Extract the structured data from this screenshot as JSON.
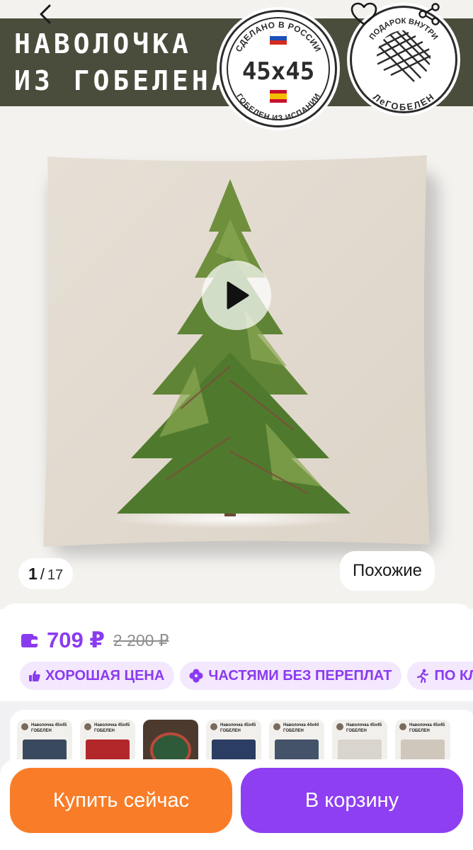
{
  "banner": {
    "line1": "НАВОЛОЧКА",
    "line2": "ИЗ ГОБЕЛЕНА",
    "seal_top": "СДЕЛАНО В РОССИИ",
    "seal_size": "45x45",
    "seal_bottom": "ГОБЕЛЕН ИЗ ИСПАНИИ",
    "brand_top": "ПОДАРОК ВНУТРИ",
    "brand_name": "ЛеГОБЕЛЕН"
  },
  "gallery": {
    "current": "1",
    "separator": "/",
    "total": "17",
    "similar_label": "Похожие"
  },
  "icons": {
    "back": "chevron-left-icon",
    "favorite": "heart-icon",
    "share": "share-icon",
    "play": "play-icon",
    "wallet": "wallet-icon"
  },
  "product": {
    "price": "709 ₽",
    "old_price": "2 200 ₽"
  },
  "badges": [
    {
      "label": "ХОРОШАЯ ЦЕНА",
      "icon": "thumbs-up-icon"
    },
    {
      "label": "ЧАСТЯМИ БЕЗ ПЕРЕПЛАТ",
      "icon": "clover-icon"
    },
    {
      "label": "ПО КЛ",
      "icon": "running-person-icon"
    }
  ],
  "related": [
    {
      "label": "Наволочка 45x45 ГОБЕЛЕН"
    },
    {
      "label": "Наволочка 45x45 ГОБЕЛЕН"
    },
    {
      "label": ""
    },
    {
      "label": "Наволочка 45x45 ГОБЕЛЕН"
    },
    {
      "label": "Наволочка 44x44 ГОБЕЛЕН"
    },
    {
      "label": "Наволочка 45x45 ГОБЕЛЕН"
    },
    {
      "label": "Наволочка 45x45 ГОБЕЛЕН"
    }
  ],
  "actions": {
    "buy_now": "Купить сейчас",
    "add_to_cart": "В корзину"
  },
  "colors": {
    "accent": "#8a3bf0",
    "buy": "#f97d28",
    "cart": "#8e3ff2",
    "banner": "#4a4d3c"
  }
}
